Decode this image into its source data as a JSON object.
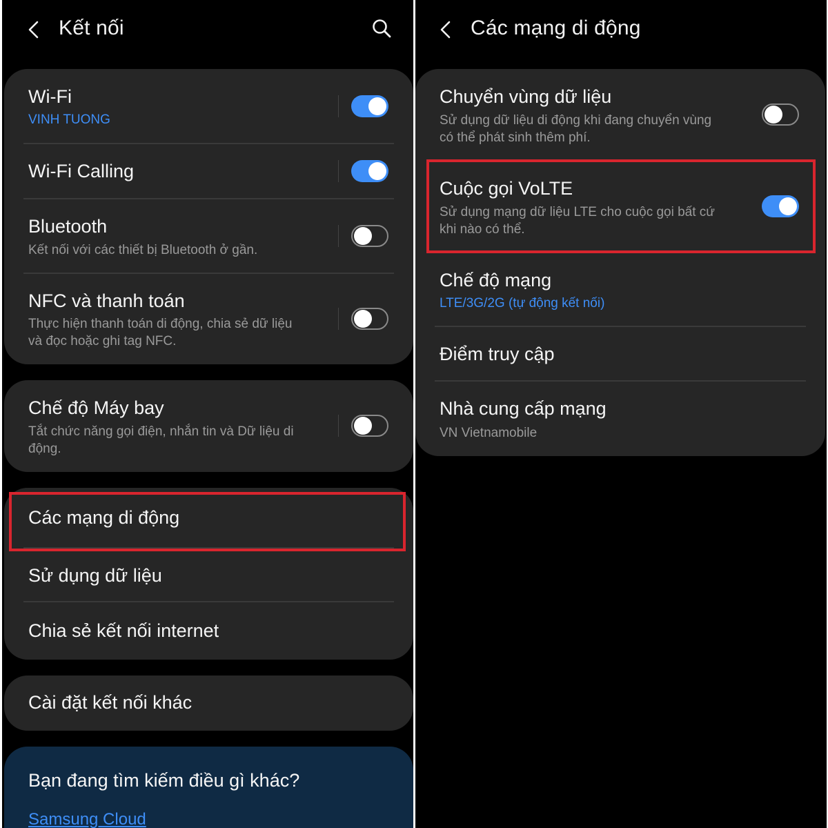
{
  "left_screen": {
    "title": "Kết nối",
    "card1": {
      "wifi": {
        "title": "Wi-Fi",
        "sub": "VINH TUONG",
        "enabled": true
      },
      "wifi_calling": {
        "title": "Wi-Fi Calling",
        "enabled": true
      },
      "bluetooth": {
        "title": "Bluetooth",
        "sub": "Kết nối với các thiết bị Bluetooth ở gần.",
        "enabled": false
      },
      "nfc": {
        "title": "NFC và thanh toán",
        "sub1": "Thực hiện thanh toán di động, chia sẻ dữ liệu",
        "sub2": "và đọc hoặc ghi tag NFC.",
        "enabled": false
      }
    },
    "card2": {
      "airplane": {
        "title": "Chế độ Máy bay",
        "sub1": "Tắt chức năng gọi điện, nhắn tin và Dữ liệu di",
        "sub2": "động.",
        "enabled": false
      }
    },
    "card3": {
      "mobile_networks": "Các mạng di động",
      "data_usage": "Sử dụng dữ liệu",
      "hotspot": "Chia sẻ kết nối internet"
    },
    "card4": {
      "more_settings": "Cài đặt kết nối khác"
    },
    "card5": {
      "looking_for": "Bạn đang tìm kiếm điều gì khác?",
      "link": "Samsung Cloud"
    }
  },
  "right_screen": {
    "title": "Các mạng di động",
    "roaming": {
      "title": "Chuyển vùng dữ liệu",
      "sub1": "Sử dụng dữ liệu di động khi đang chuyển vùng",
      "sub2": "có thể phát sinh thêm phí.",
      "enabled": false
    },
    "volte": {
      "title": "Cuộc gọi VoLTE",
      "sub1": "Sử dụng mạng dữ liệu LTE cho cuộc gọi bất cứ",
      "sub2": "khi nào có thể.",
      "enabled": true
    },
    "network_mode": {
      "title": "Chế độ mạng",
      "sub": "LTE/3G/2G (tự động kết nối)"
    },
    "access_points": {
      "title": "Điểm truy cập"
    },
    "operators": {
      "title": "Nhà cung cấp mạng",
      "sub": "VN Vietnamobile"
    }
  },
  "colors": {
    "accent": "#3e8ef7",
    "highlight": "#d9252e",
    "card": "#262626",
    "background": "#000000"
  },
  "icons": [
    "back-arrow-icon",
    "search-icon"
  ]
}
